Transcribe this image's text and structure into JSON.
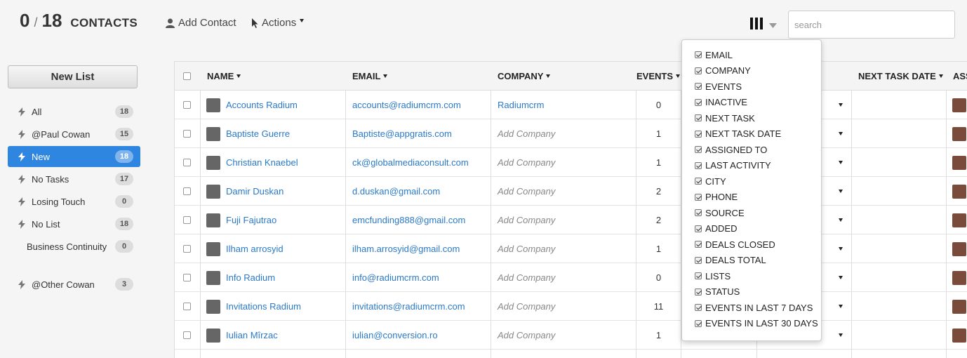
{
  "header": {
    "selected_count": "0",
    "slash": "/",
    "total_count": "18",
    "title": "CONTACTS",
    "add_contact_label": "Add Contact",
    "actions_label": "Actions"
  },
  "search": {
    "placeholder": "search",
    "value": ""
  },
  "sidebar": {
    "new_list_label": "New List",
    "items": [
      {
        "label": "All",
        "count": "18"
      },
      {
        "label": "@Paul Cowan",
        "count": "15"
      },
      {
        "label": "New",
        "count": "18"
      },
      {
        "label": "No Tasks",
        "count": "17"
      },
      {
        "label": "Losing Touch",
        "count": "0"
      },
      {
        "label": "No List",
        "count": "18"
      },
      {
        "label": "Business Continuity",
        "count": "0"
      },
      {
        "label": "@Other Cowan",
        "count": "3"
      }
    ]
  },
  "table": {
    "columns": [
      "NAME",
      "EMAIL",
      "COMPANY",
      "EVENTS",
      "NEXT TASK DATE",
      "ASS"
    ],
    "rows": [
      {
        "name": "Accounts Radium",
        "email": "accounts@radiumcrm.com",
        "company": "Radiumcrm",
        "events": "0"
      },
      {
        "name": "Baptiste Guerre",
        "email": "Baptiste@appgratis.com",
        "company": "Add Company",
        "events": "1"
      },
      {
        "name": "Christian Knaebel",
        "email": "ck@globalmediaconsult.com",
        "company": "Add Company",
        "events": "1"
      },
      {
        "name": "Damir Duskan",
        "email": "d.duskan@gmail.com",
        "company": "Add Company",
        "events": "2"
      },
      {
        "name": "Fuji Fajutrao",
        "email": "emcfunding888@gmail.com",
        "company": "Add Company",
        "events": "2"
      },
      {
        "name": "Ilham arrosyid",
        "email": "ilham.arrosyid@gmail.com",
        "company": "Add Company",
        "events": "1"
      },
      {
        "name": "Info Radium",
        "email": "info@radiumcrm.com",
        "company": "Add Company",
        "events": "0"
      },
      {
        "name": "Invitations Radium",
        "email": "invitations@radiumcrm.com",
        "company": "Add Company",
        "events": "11"
      },
      {
        "name": "Iulian Mîrzac",
        "email": "iulian@conversion.ro",
        "company": "Add Company",
        "events": "1"
      }
    ]
  },
  "column_menu": {
    "items": [
      "EMAIL",
      "COMPANY",
      "EVENTS",
      "INACTIVE",
      "NEXT TASK",
      "NEXT TASK DATE",
      "ASSIGNED TO",
      "LAST ACTIVITY",
      "CITY",
      "PHONE",
      "SOURCE",
      "ADDED",
      "DEALS CLOSED",
      "DEALS TOTAL",
      "LISTS",
      "STATUS",
      "EVENTS IN LAST 7 DAYS",
      "EVENTS IN LAST 30 DAYS"
    ]
  },
  "colors": {
    "accent": "#2f86e0",
    "link": "#2a7ac8"
  }
}
